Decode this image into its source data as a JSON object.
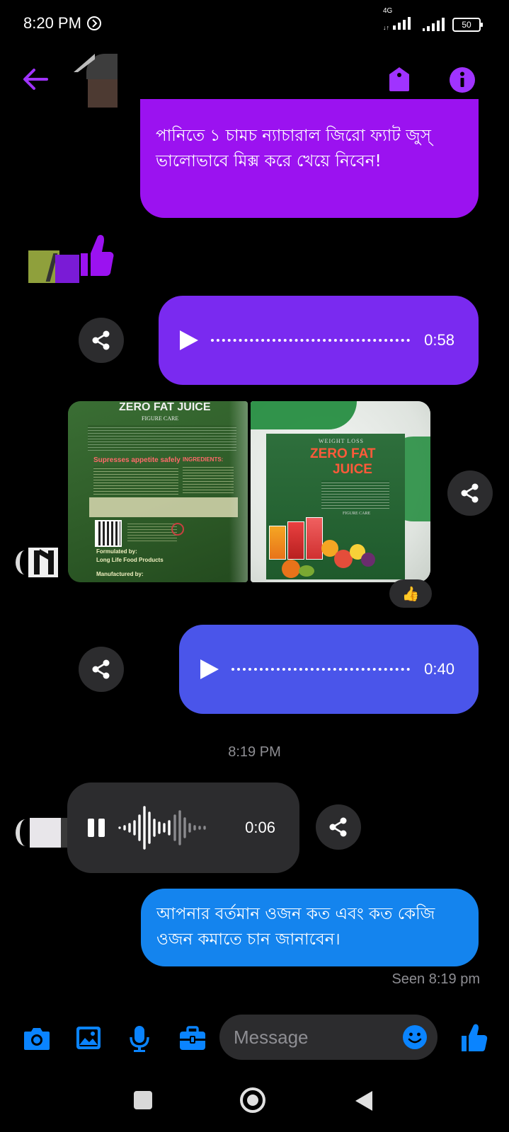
{
  "status_bar": {
    "time": "8:20 PM",
    "network": "4G",
    "battery": "50"
  },
  "header": {
    "back_icon": "arrow-left-icon",
    "tag_icon": "tag-icon",
    "info_icon": "info-icon"
  },
  "messages": {
    "top_bubble_text": "পানিতে ১ চামচ ন্যাচারাল জিরো ফ্যাট জুস্ ভালোভাবে মিক্স করে খেয়ে নিবেন!",
    "voice1_duration": "0:58",
    "image1": {
      "title": "ZERO FAT JUICE",
      "subtitle": "FIGURE CARE",
      "tagline": "Supresses appetite safely",
      "ingredients_label": "INGREDIENTS:",
      "formulated_by_label": "Formulated by:",
      "formulated_by": "Long Life Food Products",
      "manufactured_by_label": "Manufactured by:"
    },
    "image2": {
      "top_label": "WEIGHT LOSS",
      "title_line1": "ZERO FAT",
      "title_line2": "JUICE",
      "footer": "FIGURE CARE"
    },
    "reaction_emoji": "👍",
    "voice2_duration": "0:40",
    "timestamp": "8:19 PM",
    "incoming_voice_duration": "0:06",
    "last_bubble_text": "আপনার বর্তমান ওজন কত এবং কত কেজি ওজন কমাতে চান জানাবেন।",
    "seen": "Seen 8:19 pm"
  },
  "composer": {
    "placeholder": "Message",
    "icons": [
      "camera-icon",
      "gallery-icon",
      "microphone-icon",
      "toolbox-icon",
      "emoji-icon",
      "thumbs-up-icon"
    ]
  },
  "colors": {
    "purple_bubble": "#9b12f0",
    "violet_bubble": "#7a2af0",
    "indigo_bubble": "#4a55ea",
    "blue_bubble": "#1484ee",
    "accent_purple": "#a033ff",
    "messenger_blue": "#0a84ff"
  }
}
